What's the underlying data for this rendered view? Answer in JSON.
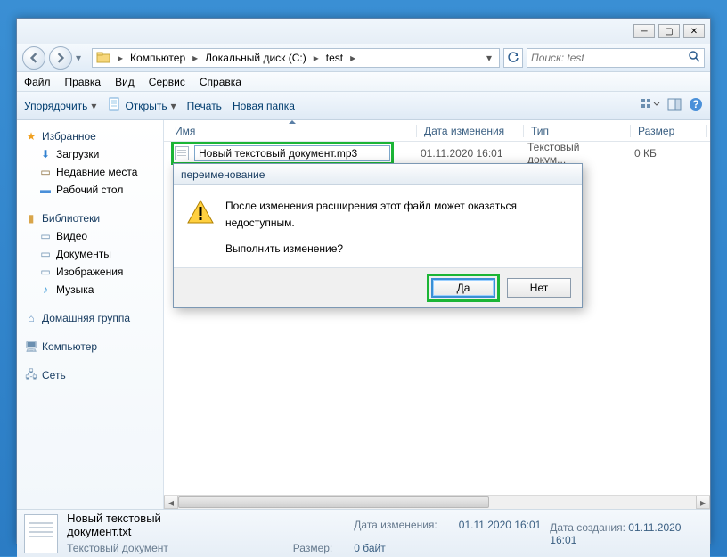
{
  "titlebar": {
    "minimize": "─",
    "maximize": "▢",
    "close": "✕"
  },
  "nav": {
    "breadcrumbs": [
      "Компьютер",
      "Локальный диск (C:)",
      "test"
    ],
    "search_placeholder": "Поиск: test"
  },
  "menubar": [
    "Файл",
    "Правка",
    "Вид",
    "Сервис",
    "Справка"
  ],
  "toolbar": {
    "organize": "Упорядочить",
    "open": "Открыть",
    "print": "Печать",
    "new_folder": "Новая папка"
  },
  "sidebar": {
    "favorites": {
      "title": "Избранное",
      "items": [
        "Загрузки",
        "Недавние места",
        "Рабочий стол"
      ]
    },
    "libraries": {
      "title": "Библиотеки",
      "items": [
        "Видео",
        "Документы",
        "Изображения",
        "Музыка"
      ]
    },
    "homegroup": {
      "title": "Домашняя группа"
    },
    "computer": {
      "title": "Компьютер"
    },
    "network": {
      "title": "Сеть"
    }
  },
  "columns": {
    "name": "Имя",
    "date": "Дата изменения",
    "type": "Тип",
    "size": "Размер"
  },
  "file": {
    "rename_value": "Новый текстовый документ.mp3",
    "date": "01.11.2020 16:01",
    "type": "Текстовый докум...",
    "size": "0 КБ"
  },
  "dialog": {
    "title": "переименование",
    "line1": "После изменения расширения этот файл может оказаться недоступным.",
    "line2": "Выполнить изменение?",
    "yes": "Да",
    "no": "Нет"
  },
  "details": {
    "filename": "Новый текстовый документ.txt",
    "filetype": "Текстовый документ",
    "date_mod_label": "Дата изменения:",
    "date_mod": "01.11.2020 16:01",
    "size_label": "Размер:",
    "size": "0 байт",
    "date_created_label": "Дата создания:",
    "date_created": "01.11.2020 16:01"
  }
}
